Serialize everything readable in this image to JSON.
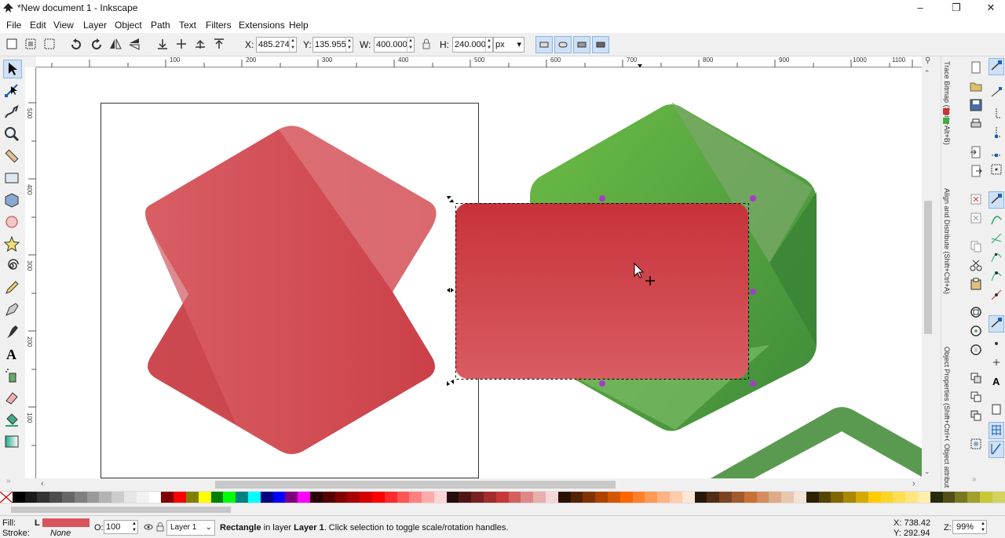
{
  "window": {
    "title": "*New document 1 - Inkscape",
    "controls": [
      "minimize",
      "restore",
      "close"
    ]
  },
  "menu": [
    "File",
    "Edit",
    "View",
    "Layer",
    "Object",
    "Path",
    "Text",
    "Filters",
    "Extensions",
    "Help"
  ],
  "toolbar": {
    "x_label": "X:",
    "x_value": "485.274",
    "y_label": "Y:",
    "y_value": "135.955",
    "w_label": "W:",
    "w_value": "400.000",
    "h_label": "H:",
    "h_value": "240.000",
    "unit": "px"
  },
  "ruler": {
    "h_ticks": [
      "100",
      "200",
      "300",
      "400",
      "500",
      "600",
      "700",
      "800",
      "900",
      "1000",
      "1100"
    ],
    "v_ticks": [
      "500",
      "400",
      "300",
      "200",
      "100"
    ]
  },
  "dock_tabs": [
    "Trace Bitmap (Shift+Alt+B)",
    "Align and Distribute (Shift+Ctrl+A)",
    "Object Properties (Shift+Ctrl+O)",
    "Object attributes"
  ],
  "statusbar": {
    "fill_label": "Fill:",
    "fill_flag": "L",
    "stroke_label": "Stroke:",
    "stroke_value": "None",
    "opacity_label": "O:",
    "opacity_value": "100",
    "layer_value": "Layer 1",
    "message_bold": "Rectangle",
    "message_mid": " in layer ",
    "message_layer": "Layer 1",
    "message_rest": ". Click selection to toggle scale/rotation handles.",
    "x_readout": "X: 738.42",
    "y_readout": "Y: 292.94",
    "zoom_label": "Z:",
    "zoom_value": "99%"
  },
  "colors": {
    "fill_swatch": "#d9545a",
    "red_shape": "#d24b52",
    "green_shape": "#5da44a",
    "selection_handle": "#a040c0",
    "accent": "#cfe1f7"
  }
}
